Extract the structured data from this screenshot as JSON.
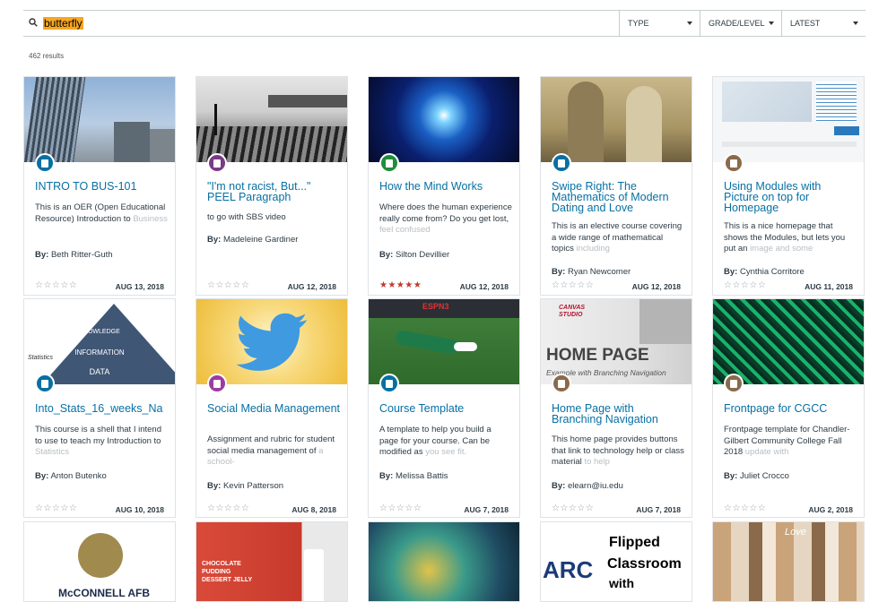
{
  "search": {
    "value": "butterfly"
  },
  "filters": [
    "TYPE",
    "GRADE/LEVEL",
    "LATEST"
  ],
  "results_count": "462 results",
  "cards": [
    {
      "title": "INTRO TO BUS-101",
      "desc": "This is an OER (Open Educational Resource) Introduction to ",
      "desc_fade": "Business",
      "author": "Beth Ritter-Guth",
      "date": "AUG 13, 2018",
      "rating": 0,
      "type": "course"
    },
    {
      "title": "\"I'm not racist, But...\" PEEL Paragraph",
      "desc": "to go with SBS video",
      "desc_fade": "",
      "author": "Madeleine Gardiner",
      "date": "AUG 12, 2018",
      "rating": 0,
      "type": "discussion"
    },
    {
      "title": "How the Mind Works",
      "desc": "Where does the human experience really come from? Do you get lost, ",
      "desc_fade": "feel confused",
      "author": "Silton Devillier",
      "date": "AUG 12, 2018",
      "rating": 5,
      "type": "quiz"
    },
    {
      "title": "Swipe Right: The Mathematics of Modern Dating and Love",
      "desc": "This is an elective course covering a wide range of mathematical topics ",
      "desc_fade": "including",
      "author": "Ryan Newcomer",
      "date": "AUG 12, 2018",
      "rating": 0,
      "type": "course"
    },
    {
      "title": "Using Modules with Picture on top for Homepage",
      "desc": "This is a nice homepage that shows the Modules, but lets you put an ",
      "desc_fade": "image and some",
      "author": "Cynthia Corritore",
      "date": "AUG 11, 2018",
      "rating": 0,
      "type": "page"
    },
    {
      "title": "Into_Stats_16_weeks_Na",
      "desc": "This course is a shell that I intend to use to teach my Introduction to ",
      "desc_fade": "Statistics",
      "author": "Anton Butenko",
      "date": "AUG 10, 2018",
      "rating": 0,
      "type": "course"
    },
    {
      "title": "Social Media Management",
      "desc": "Assignment and rubric for student social media management of ",
      "desc_fade": "a school-",
      "author": "Kevin Patterson",
      "date": "AUG 8, 2018",
      "rating": 0,
      "type": "assignment"
    },
    {
      "title": "Course Template",
      "desc": "A template to help you build a page for your course. Can be modified as ",
      "desc_fade": "you see fit.",
      "author": "Melissa Battis",
      "date": "AUG 7, 2018",
      "rating": 0,
      "type": "course"
    },
    {
      "title": "Home Page with Branching Navigation",
      "desc": "This home page provides buttons that link to technology help or class material ",
      "desc_fade": "to help",
      "author": "elearn@iu.edu",
      "date": "AUG 7, 2018",
      "rating": 0,
      "type": "page"
    },
    {
      "title": "Frontpage for CGCC",
      "desc": "Frontpage template for Chandler-Gilbert Community College Fall 2018 ",
      "desc_fade": "update with",
      "author": "Juliet Crocco",
      "date": "AUG 2, 2018",
      "rating": 0,
      "type": "page"
    }
  ],
  "thumb_text": {
    "pyramid": [
      "KNOWLEDGE",
      "INFORMATION",
      "DATA"
    ],
    "statistics": "Statistics",
    "espn": "ESPN3",
    "canvas_studio": "CANVAS STUDIO",
    "home_page": "HOME PAGE",
    "home_page_sub": "Example with Branching Navigation",
    "mcconnell": "McCONNELL AFB",
    "chocolate": "CHOCOLATE PUDDING DESSERT JELLY",
    "flipped": [
      "Flipped",
      "Classroom",
      "with"
    ],
    "arc": "ARC",
    "love": "Love"
  },
  "stars_empty": "☆☆☆☆☆",
  "stars_full": "★★★★★",
  "by_label": "By:"
}
